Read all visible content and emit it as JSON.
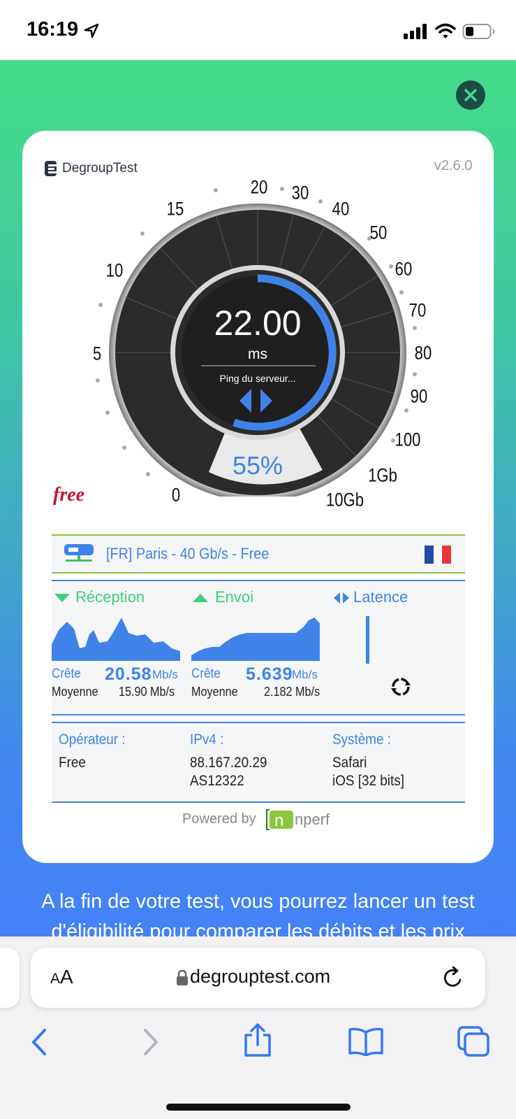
{
  "status_bar": {
    "time": "16:19"
  },
  "widget": {
    "brand": "DegroupTest",
    "version": "v2.6.0",
    "gauge": {
      "scale_labels": [
        "0",
        "5",
        "10",
        "15",
        "20",
        "30",
        "40",
        "50",
        "60",
        "70",
        "80",
        "90",
        "100",
        "1Gb",
        "10Gb"
      ],
      "value": "22.00",
      "unit": "ms",
      "status": "Ping du serveur...",
      "progress_text": "55%",
      "progress_fraction": 0.55
    },
    "isp_logo": "free",
    "server": {
      "label": "[FR] Paris - 40 Gb/s - Free",
      "flag_colors": [
        "#2349a6",
        "#ffffff",
        "#e8373c"
      ]
    },
    "results": {
      "reception": {
        "title": "Réception",
        "peak_label": "Crête",
        "peak_value": "20.58",
        "peak_unit": "Mb/s",
        "avg_label": "Moyenne",
        "avg_value": "15.90 Mb/s"
      },
      "envoi": {
        "title": "Envoi",
        "peak_label": "Crête",
        "peak_value": "5.639",
        "peak_unit": "Mb/s",
        "avg_label": "Moyenne",
        "avg_value": "2.182 Mb/s"
      },
      "latence": {
        "title": "Latence"
      }
    },
    "info": {
      "operator": {
        "label": "Opérateur :",
        "value": "Free"
      },
      "ipv4": {
        "label": "IPv4 :",
        "value": "88.167.20.29",
        "value2": "AS12322"
      },
      "system": {
        "label": "Système :",
        "value": "Safari",
        "value2": "iOS [32 bits]"
      }
    },
    "powered_by": "Powered by",
    "powered_brand": "nperf"
  },
  "promo": {
    "line1": "A la fin de votre test, vous pourrez lancer un test",
    "line2": "d'éligibilité pour comparer les débits et les prix"
  },
  "browser": {
    "aa_small": "A",
    "aa_big": "A",
    "url": "degrouptest.com"
  },
  "colors": {
    "accent": "#3f83e8",
    "reception": "#3ecf7a",
    "gauge_face": "#2b2b2b"
  }
}
